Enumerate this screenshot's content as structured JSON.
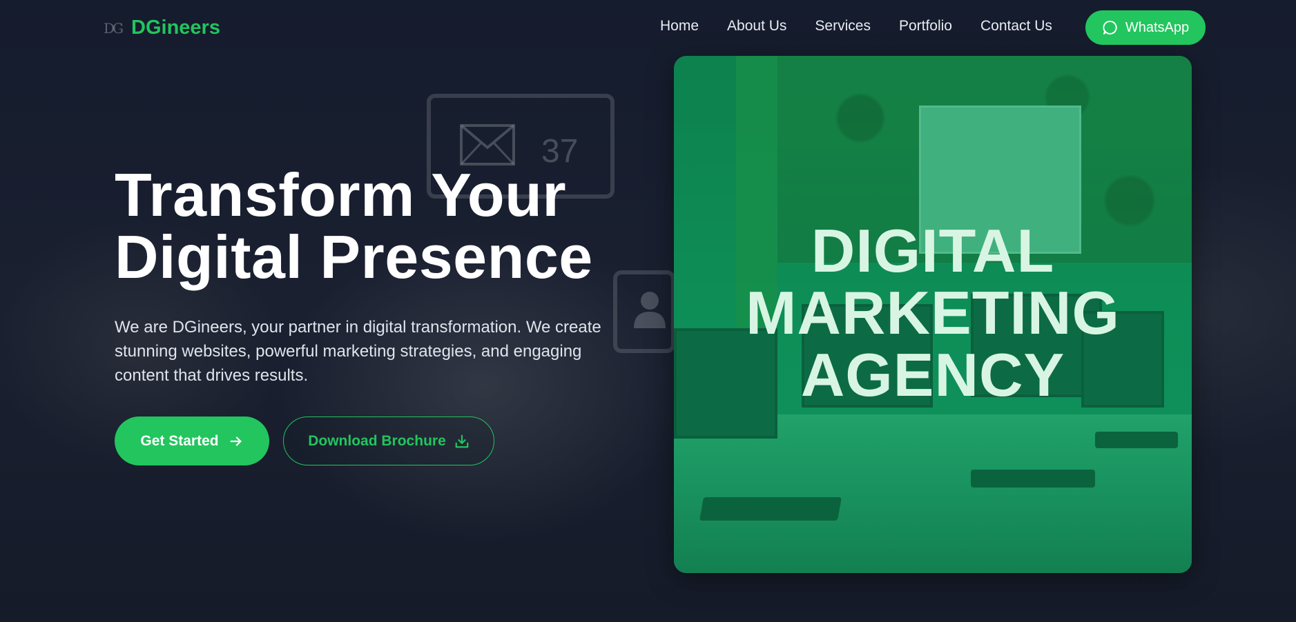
{
  "brand": {
    "mark": "DG",
    "name": "DGineers",
    "accent_color": "#22c55e"
  },
  "nav": {
    "items": [
      {
        "label": "Home"
      },
      {
        "label": "About Us"
      },
      {
        "label": "Services"
      },
      {
        "label": "Portfolio"
      },
      {
        "label": "Contact Us"
      }
    ],
    "whatsapp_label": "WhatsApp",
    "whatsapp_icon": "whatsapp-chat-icon"
  },
  "hero": {
    "title_line1": "Transform Your",
    "title_line2": "Digital Presence",
    "description": "We are DGineers, your partner in digital transformation. We create stunning websites, powerful marketing strategies, and engaging content that drives results.",
    "primary_button": "Get Started",
    "primary_icon": "arrow-right-icon",
    "secondary_button": "Download Brochure",
    "secondary_icon": "download-icon"
  },
  "hero_image": {
    "line1": "DIGITAL",
    "line2": "MARKETING",
    "line3": "AGENCY"
  },
  "background": {
    "mail_count": "37"
  }
}
